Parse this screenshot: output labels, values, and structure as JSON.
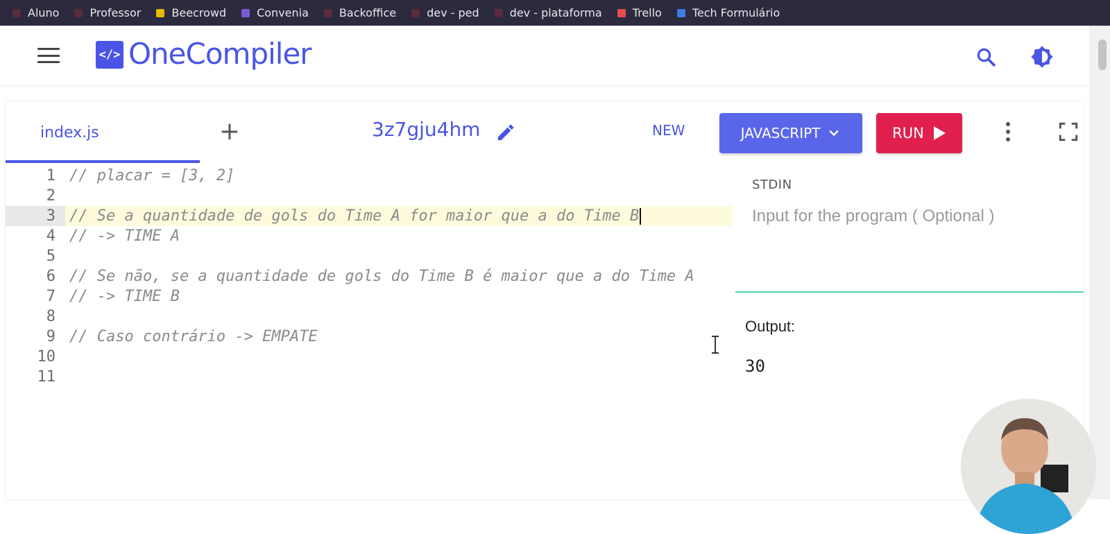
{
  "bookmarks": [
    {
      "label": "Aluno",
      "color": "#5a2b3a"
    },
    {
      "label": "Professor",
      "color": "#5a2b3a"
    },
    {
      "label": "Beecrowd",
      "color": "#e6b800"
    },
    {
      "label": "Convenia",
      "color": "#7a5bd6"
    },
    {
      "label": "Backoffice",
      "color": "#5a2b3a"
    },
    {
      "label": "dev - ped",
      "color": "#5a2b3a"
    },
    {
      "label": "dev - plataforma",
      "color": "#5a2b3a"
    },
    {
      "label": "Trello",
      "color": "#e84c4c"
    },
    {
      "label": "Tech Formulário",
      "color": "#3b7de0"
    }
  ],
  "header": {
    "logo_symbol": "</>",
    "logo_text": "OneCompiler",
    "search_icon": "search-icon",
    "theme_icon": "theme-toggle-icon",
    "accent_color": "#4a55e6"
  },
  "toolbar": {
    "tab_label": "index.js",
    "add_tab_label": "+",
    "code_name": "3z7gju4hm",
    "new_label": "NEW",
    "language_label": "JAVASCRIPT",
    "run_label": "RUN"
  },
  "editor": {
    "active_line": 3,
    "lines": [
      {
        "num": "1",
        "text": "// placar = [3, 2]"
      },
      {
        "num": "2",
        "text": ""
      },
      {
        "num": "3",
        "text": "// Se a quantidade de gols do Time A for maior que a do Time B"
      },
      {
        "num": "4",
        "text": "// -> TIME A"
      },
      {
        "num": "5",
        "text": ""
      },
      {
        "num": "6",
        "text": "// Se não, se a quantidade de gols do Time B é maior que a do Time A"
      },
      {
        "num": "7",
        "text": "// -> TIME B"
      },
      {
        "num": "8",
        "text": ""
      },
      {
        "num": "9",
        "text": "// Caso contrário -> EMPATE"
      },
      {
        "num": "10",
        "text": ""
      },
      {
        "num": "11",
        "text": ""
      }
    ]
  },
  "stdin": {
    "label": "STDIN",
    "placeholder": "Input for the program ( Optional )"
  },
  "output": {
    "label": "Output:",
    "value": "30"
  },
  "colors": {
    "run_button": "#e01f4f",
    "language_button": "#5a66ea",
    "divider": "#4fd1a5"
  }
}
